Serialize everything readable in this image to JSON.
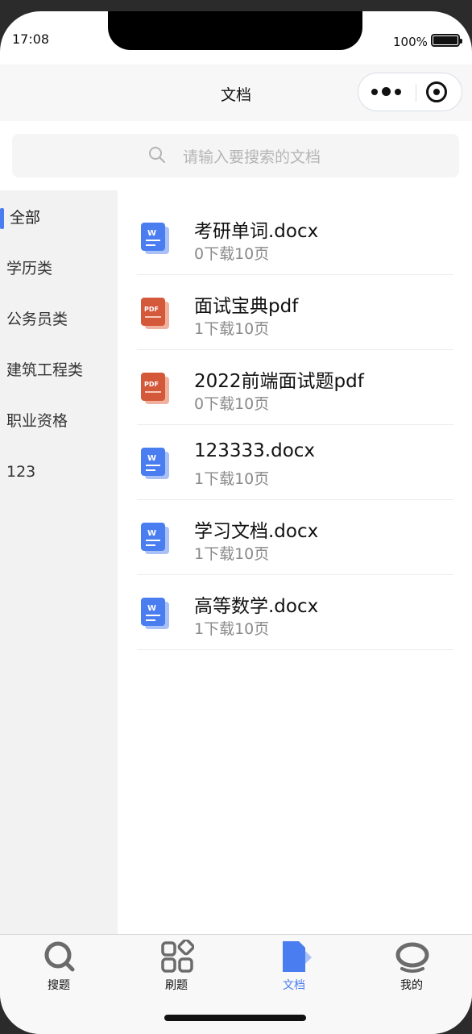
{
  "status": {
    "time": "17:08",
    "battery": "100%"
  },
  "navbar": {
    "title": "文档"
  },
  "search": {
    "placeholder": "请输入要搜索的文档"
  },
  "sidebar": {
    "items": [
      {
        "label": "全部",
        "active": true
      },
      {
        "label": "学历类"
      },
      {
        "label": "公务员类"
      },
      {
        "label": "建筑工程类"
      },
      {
        "label": "职业资格"
      },
      {
        "label": "123"
      }
    ]
  },
  "documents": [
    {
      "name": "考研单词.docx",
      "meta": "0下载10页",
      "type": "word-icon"
    },
    {
      "name": "面试宝典pdf",
      "meta": "1下载10页",
      "type": "pdf-icon"
    },
    {
      "name": "2022前端面试题pdf",
      "meta": "0下载10页",
      "type": "pdf-icon"
    },
    {
      "name": "123333.docx",
      "meta": "1下载10页",
      "type": "word-icon"
    },
    {
      "name": "学习文档.docx",
      "meta": "1下载10页",
      "type": "word-icon"
    },
    {
      "name": "高等数学.docx",
      "meta": "1下载10页",
      "type": "word-icon"
    }
  ],
  "icon_labels": {
    "word": "W",
    "pdf": "PDF"
  },
  "tabbar": {
    "items": [
      {
        "label": "搜题",
        "icon": "search-icon"
      },
      {
        "label": "刷题",
        "icon": "grid-icon"
      },
      {
        "label": "文档",
        "icon": "document-icon",
        "active": true
      },
      {
        "label": "我的",
        "icon": "profile-icon"
      }
    ]
  },
  "colors": {
    "accent": "#4a7df0",
    "word": "#4a7df0",
    "pdf": "#d4583a"
  }
}
